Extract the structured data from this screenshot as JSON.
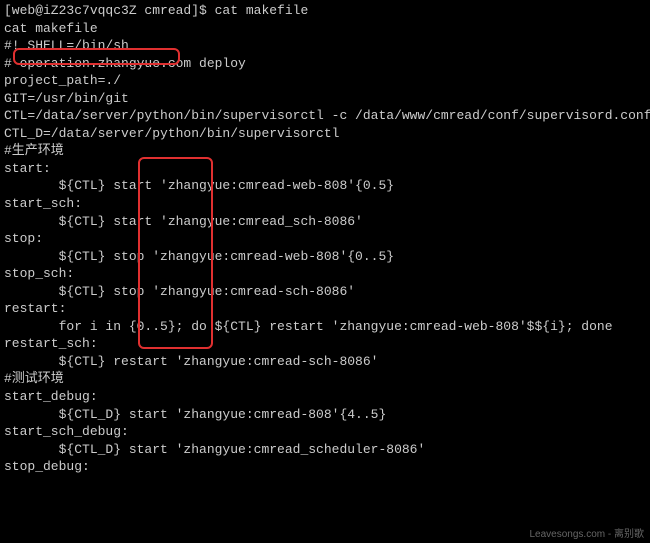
{
  "lines": {
    "l0": "[web@iZ23c7vqqc3Z cmread]$ cat makefile",
    "l1": "cat makefile",
    "l2": "#! SHELL=/bin/sh",
    "l3": "# operation.zhangyue.com deploy",
    "l4": "",
    "l5": "project_path=./",
    "l6": "GIT=/usr/bin/git",
    "l7": "CTL=/data/server/python/bin/supervisorctl -c /data/www/cmread/conf/supervisord.conf",
    "l8": "CTL_D=/data/server/python/bin/supervisorctl",
    "l9": "#生产环境",
    "l10": "start:",
    "l11": "       ${CTL} start 'zhangyue:cmread-web-808'{0.5}",
    "l12": "start_sch:",
    "l13": "       ${CTL} start 'zhangyue:cmread_sch-8086'",
    "l14": "",
    "l15": "stop:",
    "l16": "       ${CTL} stop 'zhangyue:cmread-web-808'{0..5}",
    "l17": "stop_sch:",
    "l18": "       ${CTL} stop 'zhangyue:cmread-sch-8086'",
    "l19": "",
    "l20": "restart:",
    "l21": "       for i in {0..5}; do ${CTL} restart 'zhangyue:cmread-web-808'$${i}; done",
    "l22": "restart_sch:",
    "l23": "       ${CTL} restart 'zhangyue:cmread-sch-8086'",
    "l24": "",
    "l25": "#测试环境",
    "l26": "start_debug:",
    "l27": "       ${CTL_D} start 'zhangyue:cmread-808'{4..5}",
    "l28": "start_sch_debug:",
    "l29": "       ${CTL_D} start 'zhangyue:cmread_scheduler-8086'",
    "l30": "",
    "l31": "stop_debug:"
  },
  "watermark": "Leavesongs.com - 离别歌"
}
